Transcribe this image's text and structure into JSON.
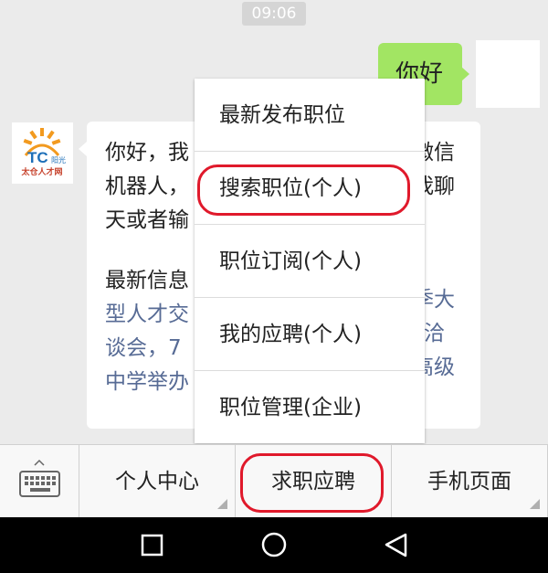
{
  "status": {
    "time": "09:06"
  },
  "messages": {
    "me": {
      "text": "你好"
    },
    "bot": {
      "logo": {
        "brand": "TC",
        "tag": "阳光",
        "name": "太仓人才网"
      },
      "lines": [
        "你好，我",
        "机器人，",
        "天或者输"
      ],
      "lines_right": [
        "微信",
        "我聊",
        ""
      ],
      "info_lines": [
        "最新信息",
        "型人才交",
        "谈会，7",
        "中学举办"
      ],
      "info_lines_right": [
        "季大",
        "”洽",
        "高级",
        ""
      ]
    }
  },
  "popup": {
    "items": [
      {
        "label": "最新发布职位"
      },
      {
        "label": "搜索职位(个人)"
      },
      {
        "label": "职位订阅(个人)"
      },
      {
        "label": "我的应聘(个人)"
      },
      {
        "label": "职位管理(企业)"
      }
    ]
  },
  "menubar": {
    "keyboard_icon": "keyboard-icon",
    "items": [
      {
        "label": "个人中心"
      },
      {
        "label": "求职应聘"
      },
      {
        "label": "手机页面"
      }
    ]
  },
  "navbar": {
    "icons": [
      "recent-apps-icon",
      "home-icon",
      "back-icon"
    ]
  },
  "colors": {
    "accent_green": "#a2e563",
    "highlight_red": "#e0192b",
    "link_blue": "#576b95"
  }
}
